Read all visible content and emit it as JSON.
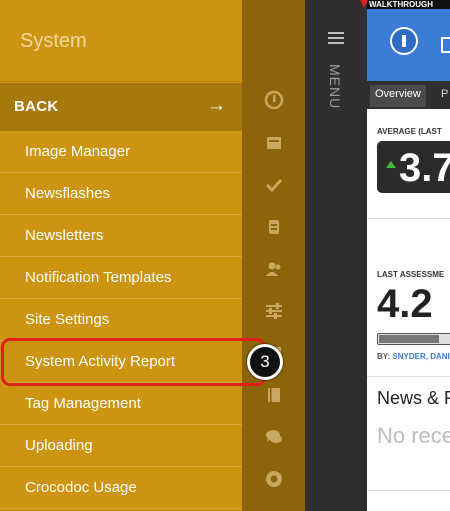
{
  "menu": {
    "title": "System",
    "back_label": "BACK",
    "back_arrow": "→",
    "items": [
      {
        "label": "Image Manager"
      },
      {
        "label": "Newsflashes"
      },
      {
        "label": "Newsletters"
      },
      {
        "label": "Notification Templates"
      },
      {
        "label": "Site Settings"
      },
      {
        "label": "System Activity Report"
      },
      {
        "label": "Tag Management"
      },
      {
        "label": "Uploading"
      },
      {
        "label": "Crocodoc Usage"
      }
    ]
  },
  "callout": {
    "step": "3",
    "color": "#e0201a"
  },
  "rail_icons": [
    "dashboard-icon",
    "inbox-icon",
    "check-icon",
    "briefcase-icon",
    "users-icon",
    "sliders-icon",
    "calendar-icon",
    "book-icon",
    "chat-icon",
    "lifebuoy-icon"
  ],
  "side_menu": {
    "label": "MENU"
  },
  "walkthrough": {
    "label": "WALKTHROUGH"
  },
  "dashboard": {
    "tabs": [
      "Overview",
      "P"
    ],
    "avg_label": "AVERAGE (LAST",
    "avg_value": "3.7",
    "last_label": "LAST ASSESSME",
    "last_value": "4.2",
    "by_prefix": "BY:",
    "by_name": "SNYDER, DANI",
    "news_title": "News & R",
    "news_empty": "No rece"
  },
  "colors": {
    "menu_bg": "#cc9411",
    "back_bg": "#a7780b",
    "rail_bg": "#8c650a",
    "accent_blue": "#3a7bd5"
  }
}
